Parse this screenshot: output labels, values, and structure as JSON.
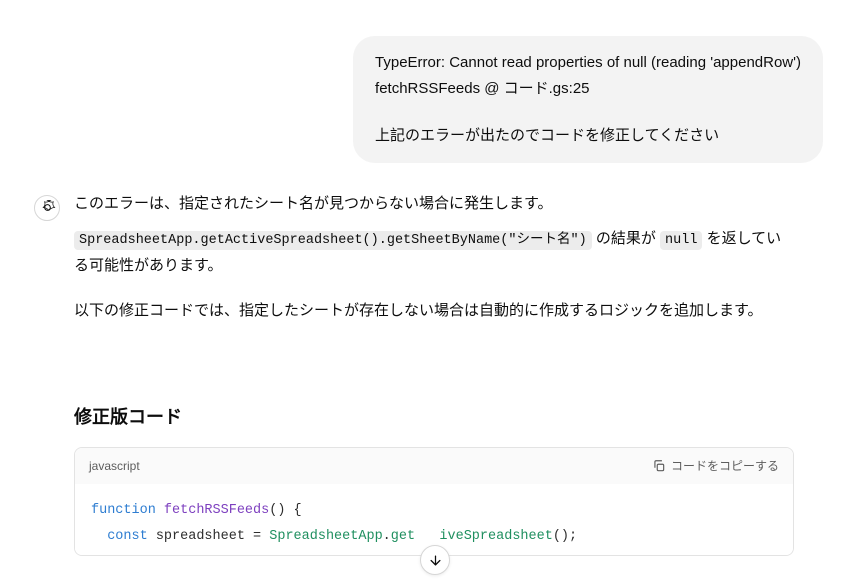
{
  "user_message": {
    "error_line1": "TypeError: Cannot read properties of null (reading 'appendRow')",
    "error_line2": "fetchRSSFeeds @ コード.gs:25",
    "request": "上記のエラーが出たのでコードを修正してください"
  },
  "assistant_message": {
    "para1": "このエラーは、指定されたシート名が見つからない場合に発生します。",
    "code1": "SpreadsheetApp.getActiveSpreadsheet().getSheetByName(\"シート名\")",
    "para2_mid": " の結果が ",
    "code2": "null",
    "para2_end": " を返している可能性があります。",
    "para3": "以下の修正コードでは、指定したシートが存在しない場合は自動的に作成するロジックを追加します。",
    "heading": "修正版コード",
    "code_lang": "javascript",
    "copy_label": "コードをコピーする",
    "code": {
      "line1_kw": "function",
      "line1_fn": "fetchRSSFeeds",
      "line1_rest": "() {",
      "line2_indent": "  ",
      "line2_kw": "const",
      "line2_var": " spreadsheet = ",
      "line2_obj1": "SpreadsheetApp",
      "line2_dot": ".",
      "line2_m1a": "get",
      "line2_m1b": "iveSpreadsheet",
      "line2_rest": "();"
    }
  }
}
